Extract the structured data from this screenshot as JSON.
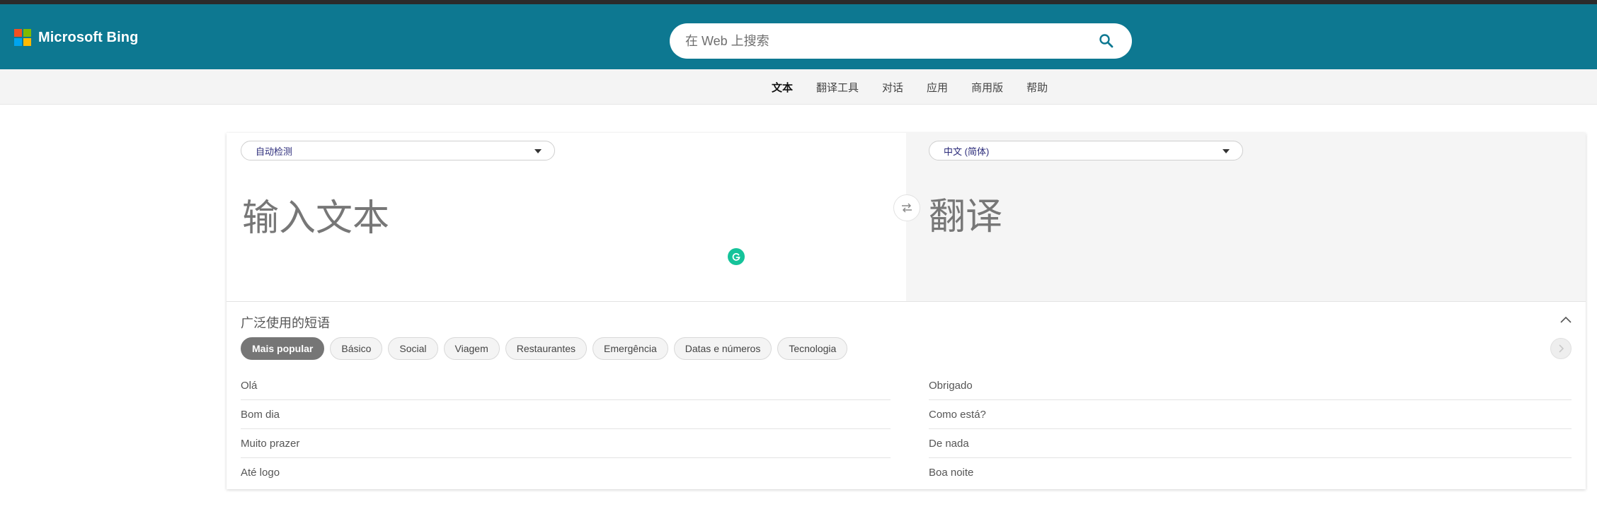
{
  "header": {
    "brand": "Microsoft Bing",
    "logo_colors": [
      "#f25022",
      "#7fba00",
      "#00a4ef",
      "#ffb900"
    ],
    "search_placeholder": "在 Web 上搜索",
    "search_icon": "search-icon"
  },
  "nav": {
    "items": [
      {
        "label": "文本",
        "active": true
      },
      {
        "label": "翻译工具"
      },
      {
        "label": "对话"
      },
      {
        "label": "应用"
      },
      {
        "label": "商用版"
      },
      {
        "label": "帮助"
      }
    ]
  },
  "translator": {
    "source_lang": "自动检测",
    "target_lang": "中文 (简体)",
    "source_placeholder": "输入文本",
    "target_placeholder": "翻译",
    "swap_icon": "swap-icon"
  },
  "phrases": {
    "title": "广泛使用的短语",
    "categories": [
      {
        "label": "Mais popular",
        "active": true
      },
      {
        "label": "Básico"
      },
      {
        "label": "Social"
      },
      {
        "label": "Viagem"
      },
      {
        "label": "Restaurantes"
      },
      {
        "label": "Emergência"
      },
      {
        "label": "Datas e números"
      },
      {
        "label": "Tecnologia"
      }
    ],
    "left": [
      "Olá",
      "Bom dia",
      "Muito prazer",
      "Até logo"
    ],
    "right": [
      "Obrigado",
      "Como está?",
      "De nada",
      "Boa noite"
    ]
  },
  "colors": {
    "header_bg": "#0d7891",
    "grammarly": "#15c39a"
  }
}
